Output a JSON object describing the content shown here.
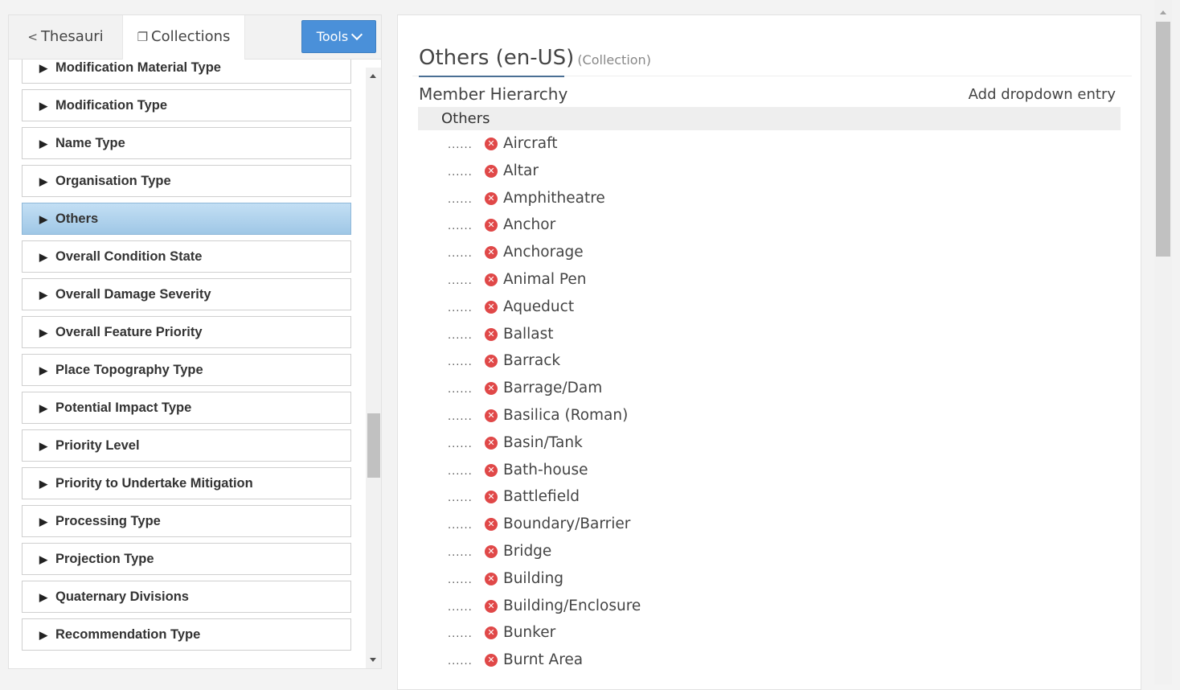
{
  "tabs": {
    "thesauri_label": "Thesauri",
    "collections_label": "Collections",
    "tools_label": "Tools",
    "active": "Collections"
  },
  "collections": [
    {
      "label": "Modification Material Type",
      "active": false
    },
    {
      "label": "Modification Type",
      "active": false
    },
    {
      "label": "Name Type",
      "active": false
    },
    {
      "label": "Organisation Type",
      "active": false
    },
    {
      "label": "Others",
      "active": true
    },
    {
      "label": "Overall Condition State",
      "active": false
    },
    {
      "label": "Overall Damage Severity",
      "active": false
    },
    {
      "label": "Overall Feature Priority",
      "active": false
    },
    {
      "label": "Place Topography Type",
      "active": false
    },
    {
      "label": "Potential Impact Type",
      "active": false
    },
    {
      "label": "Priority Level",
      "active": false
    },
    {
      "label": "Priority to Undertake Mitigation",
      "active": false
    },
    {
      "label": "Processing Type",
      "active": false
    },
    {
      "label": "Projection Type",
      "active": false
    },
    {
      "label": "Quaternary Divisions",
      "active": false
    },
    {
      "label": "Recommendation Type",
      "active": false
    }
  ],
  "detail": {
    "title": "Others (en-US)",
    "subtitle": "(Collection)",
    "member_hierarchy_label": "Member Hierarchy",
    "add_entry_label": "Add dropdown entry",
    "root_label": "Others",
    "dots": "......",
    "members": [
      "Aircraft",
      "Altar",
      "Amphitheatre",
      "Anchor",
      "Anchorage",
      "Animal Pen",
      "Aqueduct",
      "Ballast",
      "Barrack",
      "Barrage/Dam",
      "Basilica (Roman)",
      "Basin/Tank",
      "Bath-house",
      "Battlefield",
      "Boundary/Barrier",
      "Bridge",
      "Building",
      "Building/Enclosure",
      "Bunker",
      "Burnt Area"
    ]
  },
  "icons": {
    "share": "share-icon",
    "collections": "copy-icon",
    "tools_chevron": "chevron-down-icon",
    "expand": "triangle-right-icon",
    "delete": "remove-circle-icon"
  },
  "colors": {
    "tools_button": "#4a90d9",
    "active_item": "#b5d6ef",
    "delete_icon": "#e04848"
  }
}
